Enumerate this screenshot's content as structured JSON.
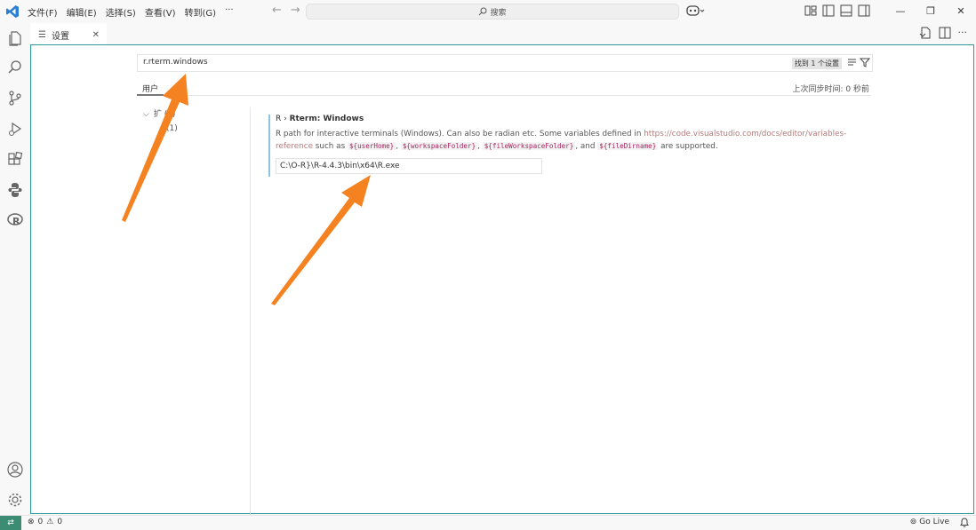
{
  "titlebar": {
    "menu": [
      "文件(F)",
      "编辑(E)",
      "选择(S)",
      "查看(V)",
      "转到(G)",
      "···"
    ],
    "search_label": "搜索"
  },
  "tab": {
    "title": "设置"
  },
  "settings": {
    "search_value": "r.rterm.windows",
    "found_label": "找到 1 个设置",
    "user_tab": "用户",
    "sync_text": "上次同步时间: 0 秒前",
    "tree": [
      "扩 (1)",
      "(1)"
    ],
    "setting_prefix": "R › ",
    "setting_name": "Rterm: Windows",
    "desc_part1": "R path for interactive terminals (Windows). Can also be radian etc. Some variables defined in ",
    "desc_link": "https://code.visualstudio.com/docs/editor/variables-reference",
    "desc_part2": " such as ",
    "code1": "${userHome}",
    "sep1": ", ",
    "code2": "${workspaceFolder}",
    "sep2": ", ",
    "code3": "${fileWorkspaceFolder}",
    "sep3": ", and ",
    "code4": "${fileDirname}",
    "desc_end": " are supported.",
    "path_value": "C:\\O-R}\\R-4.4.3\\bin\\x64\\R.exe"
  },
  "statusbar": {
    "errors": "0",
    "warnings": "0",
    "golive": "Go Live"
  },
  "colors": {
    "accent": "#2f9a9a",
    "arrow": "#f58220",
    "remote": "#3c8c74",
    "link": "#b47a7a"
  }
}
